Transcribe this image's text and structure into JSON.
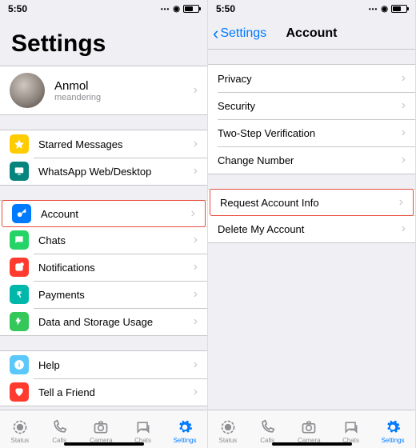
{
  "statusTime": "5:50",
  "left": {
    "title": "Settings",
    "profile": {
      "name": "Anmol",
      "subtitle": "meandering"
    },
    "group1": [
      {
        "label": "Starred Messages",
        "iconColor": "#ffcc00"
      },
      {
        "label": "WhatsApp Web/Desktop",
        "iconColor": "#07847e"
      }
    ],
    "group2": [
      {
        "label": "Account",
        "iconColor": "#007aff",
        "highlight": true
      },
      {
        "label": "Chats",
        "iconColor": "#25d366"
      },
      {
        "label": "Notifications",
        "iconColor": "#ff3b30"
      },
      {
        "label": "Payments",
        "iconColor": "#00b8a9"
      },
      {
        "label": "Data and Storage Usage",
        "iconColor": "#34c759"
      }
    ],
    "group3": [
      {
        "label": "Help",
        "iconColor": "#5ac8fa"
      },
      {
        "label": "Tell a Friend",
        "iconColor": "#ff3b30"
      }
    ]
  },
  "right": {
    "back": "Settings",
    "title": "Account",
    "group1": [
      {
        "label": "Privacy"
      },
      {
        "label": "Security"
      },
      {
        "label": "Two-Step Verification"
      },
      {
        "label": "Change Number"
      }
    ],
    "group2": [
      {
        "label": "Request Account Info",
        "highlight": true
      },
      {
        "label": "Delete My Account"
      }
    ]
  },
  "tabs": [
    {
      "label": "Status"
    },
    {
      "label": "Calls"
    },
    {
      "label": "Camera"
    },
    {
      "label": "Chats"
    },
    {
      "label": "Settings",
      "active": true
    }
  ]
}
